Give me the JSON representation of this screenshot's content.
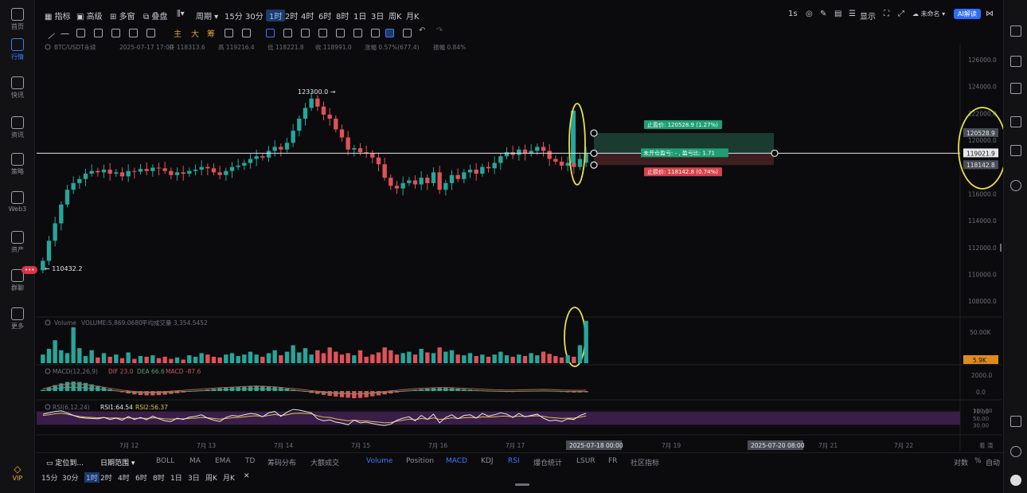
{
  "left_nav": [
    {
      "label": "首页",
      "icon": "home-icon"
    },
    {
      "label": "行情",
      "icon": "market-chart-icon",
      "active": true
    },
    {
      "label": "快讯",
      "icon": "news-flash-icon"
    },
    {
      "label": "资讯",
      "icon": "info-doc-icon"
    },
    {
      "label": "策略",
      "icon": "strategy-robot-icon"
    },
    {
      "label": "Web3",
      "icon": "web3-icon"
    },
    {
      "label": "资产",
      "icon": "wallet-icon"
    },
    {
      "label": "群聊",
      "icon": "chat-icon",
      "badge": "•••"
    },
    {
      "label": "更多",
      "icon": "more-grid-icon"
    }
  ],
  "vip_label": "VIP",
  "toolbar": {
    "indicator": "指标",
    "advanced": "高级",
    "multi": "多窗",
    "overlay": "叠盘",
    "period": "周期",
    "timeframes": [
      "15分",
      "30分",
      "1时",
      "2时",
      "4时",
      "6时",
      "8时",
      "1日",
      "3日",
      "周K",
      "月K"
    ],
    "active_timeframe": "1时",
    "right_1s": "1s",
    "display": "显示",
    "unnamed": "未命名",
    "ai": "AI解读"
  },
  "drawbar": {
    "labels": [
      "主",
      "大",
      "筹"
    ]
  },
  "legend": {
    "pair": "BTC/USDT永续",
    "datetime": "2025-07-17 17:00",
    "open": "开 118313.6",
    "high": "高 119216.4",
    "low": "低 118221.8",
    "close": "收 118991.0",
    "change": "涨幅 0.57%(677.4)",
    "amplitude": "振幅 0.84%"
  },
  "price_axis": [
    "126000.0",
    "124000.0",
    "122000.0",
    "120000.0",
    "118000.0",
    "116000.0",
    "114000.0",
    "112000.0",
    "110000.0",
    "108000.0"
  ],
  "axis_tags": {
    "tp": "120528.9",
    "current": "119021.9",
    "sl": "118142.8"
  },
  "annotations": {
    "high": "123300.0",
    "low": "110432.2"
  },
  "order": {
    "tp_label": "止盈价: 120528.9 (1.27%)",
    "mid_label": "未开仓盈亏: - , 盈亏比: 1.71",
    "sl_label": "止损价: 118142.8 (0.74%)"
  },
  "volume": {
    "title": "Volume",
    "value": "VOLUME:5,869.0680",
    "ma": "平均成交量 3,354.5452",
    "axis_50k": "50.00K",
    "tag": "5.9K"
  },
  "macd": {
    "title": "MACD(12,26,9)",
    "dif": "DIF 23.0",
    "dea": "DEA 66.6",
    "macd": "MACD -87.6",
    "axis": [
      "2000.0",
      "0.0"
    ]
  },
  "rsi": {
    "title": "RSI(6,12,24)",
    "rsi1": "RSI1:64.54",
    "rsi2": "RSI2:56.37",
    "axis": [
      "100.00",
      "70.00",
      "50.00",
      "30.00"
    ]
  },
  "x_axis": {
    "ticks": [
      "7月 12",
      "7月 13",
      "7月 14",
      "7月 15",
      "7月 16",
      "7月 17",
      "7月 19",
      "7月 21",
      "7月 22"
    ],
    "tag_1": "2025-07-18 00:00",
    "tag_2": "2025-07-20 08:00",
    "right_label": "着 演"
  },
  "indicator_tabs": {
    "locate": "定位到...",
    "date_range": "日期范围",
    "items": [
      "BOLL",
      "MA",
      "EMA",
      "TD",
      "筹码分布",
      "大额成交",
      "Volume",
      "Position",
      "MACD",
      "KDJ",
      "RSI",
      "爆仓统计",
      "LSUR",
      "FR",
      "社区指标"
    ],
    "active": [
      "Volume",
      "MACD",
      "RSI"
    ],
    "right": [
      "对数",
      "%",
      "自动"
    ]
  },
  "bottom_timeframes": [
    "15分",
    "30分",
    "1时",
    "2时",
    "4时",
    "6时",
    "8时",
    "1日",
    "3日",
    "周K",
    "月K",
    "✕"
  ],
  "colors": {
    "up": "#26a69a",
    "down": "#e0515a",
    "bg": "#0b0b0d",
    "highlight": "#e8e04a",
    "tp_zone": "#1a3b30",
    "sl_zone": "#3d1f22",
    "rsi_band": "#3a1d48"
  },
  "chart_data": {
    "type": "candlestick",
    "pair": "BTC/USDT",
    "timeframe": "1h",
    "ylim": [
      107000,
      127000
    ],
    "day_labels": [
      "7月 12",
      "7月 13",
      "7月 14",
      "7月 15",
      "7月 16",
      "7月 17"
    ],
    "hourly_close": [
      111000,
      112500,
      113800,
      115200,
      116300,
      116800,
      117100,
      117500,
      117700,
      117600,
      117800,
      117500,
      117600,
      117300,
      117700,
      117650,
      117850,
      117700,
      117950,
      117900,
      117700,
      117400,
      117600,
      117500,
      117700,
      117800,
      118000,
      117900,
      117600,
      117400,
      117700,
      118000,
      118100,
      118300,
      118600,
      118800,
      118700,
      119200,
      119500,
      119300,
      119800,
      120700,
      121600,
      122400,
      123100,
      122500,
      121900,
      121600,
      120800,
      120200,
      119300,
      119400,
      119100,
      119000,
      118700,
      118200,
      117200,
      116600,
      116400,
      116800,
      117000,
      116700,
      117200,
      116800,
      117600,
      116300,
      116800,
      117400,
      117100,
      117600,
      117800,
      117500,
      118000,
      117900,
      118300,
      118800,
      119100,
      118900,
      119300,
      119000,
      119200,
      119500,
      119200,
      118600,
      118400,
      118100,
      118300,
      118000,
      118600,
      119000
    ],
    "volume": [
      12,
      20,
      32,
      18,
      14,
      50,
      21,
      10,
      18,
      8,
      14,
      9,
      12,
      7,
      15,
      6,
      10,
      9,
      11,
      7,
      9,
      6,
      8,
      5,
      11,
      9,
      14,
      12,
      9,
      8,
      12,
      14,
      10,
      12,
      16,
      12,
      9,
      14,
      18,
      11,
      16,
      25,
      15,
      21,
      12,
      18,
      14,
      22,
      16,
      12,
      14,
      11,
      18,
      9,
      12,
      15,
      22,
      18,
      12,
      14,
      16,
      12,
      20,
      15,
      14,
      22,
      16,
      18,
      12,
      11,
      14,
      10,
      12,
      9,
      12,
      16,
      11,
      9,
      12,
      10,
      14,
      11,
      16,
      13,
      10,
      8,
      11,
      9,
      25,
      59
    ],
    "macd_hist": [
      5,
      15,
      25,
      32,
      38,
      40,
      38,
      34,
      28,
      22,
      15,
      8,
      2,
      -5,
      -10,
      -14,
      -17,
      -18,
      -18,
      -17,
      -15,
      -12,
      -9,
      -6,
      -3,
      0,
      3,
      6,
      9,
      12,
      14,
      16,
      18,
      20,
      22,
      23,
      22,
      20,
      18,
      14,
      10,
      6,
      2,
      -3,
      -8,
      -12,
      -16,
      -20,
      -23,
      -26,
      -28,
      -30,
      -29,
      -26,
      -22,
      -18,
      -14,
      -10,
      -6,
      -2,
      2,
      5,
      8,
      10,
      12,
      13,
      13,
      12,
      10,
      8,
      6,
      4,
      2,
      0,
      -2,
      -3,
      -4,
      -4,
      -3,
      -2,
      -1,
      0,
      1,
      0,
      -2,
      -4,
      -5,
      -6,
      -6,
      -5
    ],
    "rsi1": [
      62,
      66,
      70,
      72,
      66,
      58,
      52,
      50,
      49,
      48,
      52,
      46,
      50,
      44,
      55,
      46,
      52,
      45,
      56,
      48,
      42,
      40,
      50,
      46,
      53,
      55,
      60,
      50,
      44,
      40,
      52,
      58,
      56,
      60,
      64,
      62,
      54,
      66,
      70,
      55,
      68,
      76,
      74,
      70,
      66,
      48,
      42,
      45,
      38,
      35,
      30,
      44,
      36,
      38,
      34,
      30,
      28,
      32,
      44,
      50,
      54,
      42,
      58,
      46,
      62,
      36,
      52,
      60,
      48,
      58,
      60,
      50,
      64,
      56,
      60,
      66,
      62,
      52,
      64,
      54,
      58,
      62,
      50,
      42,
      44,
      40,
      48,
      46,
      58,
      64.54
    ],
    "rsi2": [
      58,
      60,
      63,
      65,
      62,
      58,
      55,
      53,
      52,
      51,
      52,
      50,
      51,
      49,
      51,
      49,
      50,
      49,
      51,
      50,
      48,
      47,
      48,
      48,
      49,
      50,
      52,
      51,
      49,
      47,
      49,
      51,
      52,
      54,
      56,
      57,
      55,
      58,
      61,
      58,
      60,
      64,
      65,
      64,
      63,
      57,
      53,
      52,
      48,
      45,
      42,
      44,
      42,
      42,
      40,
      38,
      36,
      37,
      41,
      44,
      47,
      45,
      49,
      47,
      51,
      46,
      48,
      51,
      49,
      51,
      52,
      51,
      54,
      53,
      54,
      56,
      56,
      54,
      56,
      55,
      56,
      57,
      55,
      52,
      51,
      49,
      50,
      50,
      53,
      56.37
    ],
    "last_candle": {
      "open": 118313.6,
      "high": 119216.4,
      "low": 118221.8,
      "close": 118991.0
    },
    "position": {
      "take_profit": 120528.9,
      "entry": 119021.9,
      "stop_loss": 118142.8,
      "rr_ratio": 1.71
    }
  }
}
